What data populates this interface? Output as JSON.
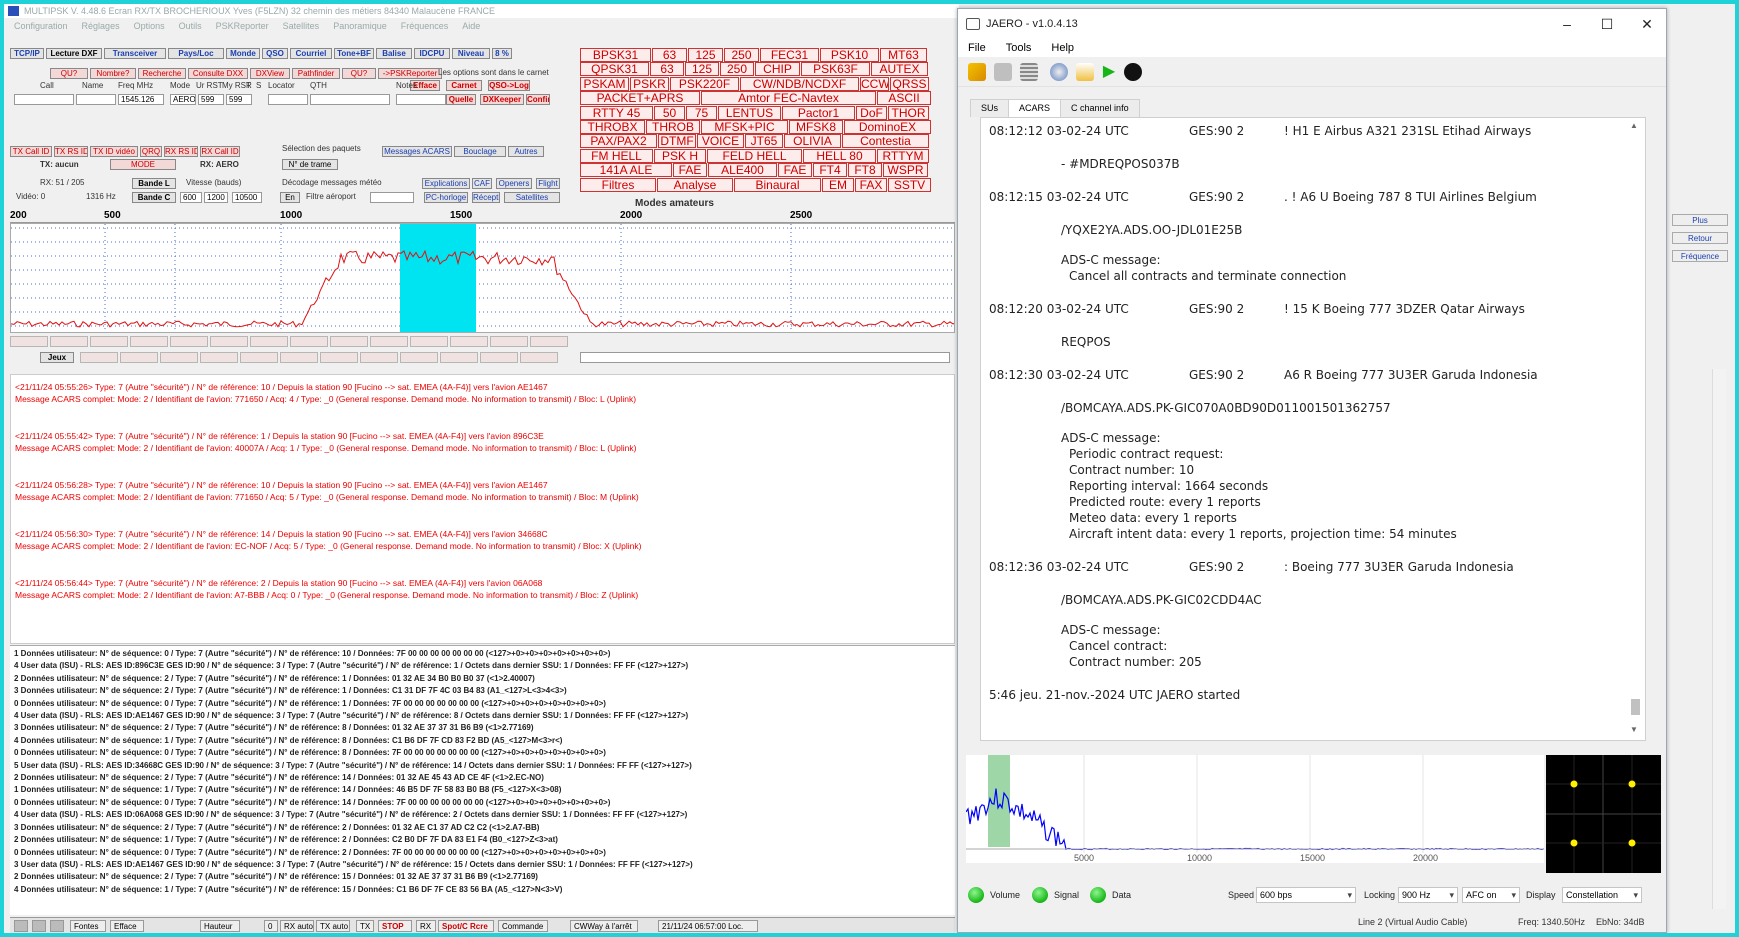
{
  "multipsk": {
    "title": "MULTIPSK V. 4.48.6  Ecran RX/TX  BROCHERIOUX Yves (F5LZN)  32 chemin des métiers  84340 Malaucène  FRANCE",
    "menu": [
      "Configuration",
      "Réglages",
      "Options",
      "Outils",
      "PSKReporter",
      "Satellites",
      "Panoramique",
      "Fréquences",
      "Aide"
    ],
    "toolbar1": [
      "TCP/IP",
      "Lecture DXF",
      "Transceiver",
      "Pays/Loc",
      "Monde",
      "QSO",
      "Courriel",
      "Tone+BF",
      "Balise",
      "IDCPU",
      "Niveau",
      "8 %"
    ],
    "toolbar2": [
      "QU?",
      "Nombre?",
      "Recherche",
      "Consulte DXX",
      "DXView",
      "Pathfinder",
      "QU?",
      "->PSKReporter"
    ],
    "carnet_note": "Les options sont dans le carnet",
    "carnet_buttons": [
      "Efface",
      "Carnet",
      "QSO->Log",
      "Quelle",
      "DXKeeper",
      "Confir"
    ],
    "log_headers": [
      "Call",
      "Name",
      "Freq MHz",
      "Mode",
      "Ur RST",
      "My RST",
      "R",
      "S",
      "Locator",
      "QTH",
      "Notes"
    ],
    "log_values": {
      "freq": "1545.126",
      "mode": "AERO",
      "ur_rst": "599",
      "my_rst": "599"
    },
    "tx_buttons": [
      "TX Call ID",
      "TX RS ID",
      "TX ID vidéo",
      "QRQ",
      "RX RS ID",
      "RX Call ID"
    ],
    "packet_selection": "Sélection des paquets",
    "acars_buttons": [
      "Messages ACARS",
      "Bouclage",
      "Autres"
    ],
    "tx_mode": {
      "tx": "TX: aucun",
      "mode": "MODE",
      "rx": "RX: AERO",
      "frame": "N° de trame"
    },
    "rx_info": {
      "rx": "RX: 51 / 205",
      "bande_l": "Bande L",
      "bande_c": "Bande C",
      "vitesse": "Vitesse (bauds)",
      "v600": "600",
      "v1200": "1200",
      "v10500": "10500",
      "weather": "Décodage messages météo",
      "en": "En",
      "filtre": "Filtre aéroport",
      "videau": "Vidéo: 0",
      "freq_hz": "1316 Hz"
    },
    "misc_buttons": [
      "Explications",
      "CAF",
      "Openers",
      "Flight",
      "PC-horloge",
      "Réception",
      "Satellites"
    ],
    "modes": [
      [
        "BPSK31",
        "63",
        "125",
        "250",
        "FEC31",
        "PSK10",
        "MT63"
      ],
      [
        "QPSK31",
        "63",
        "125",
        "250",
        "CHIP",
        "PSK63F",
        "AUTEX"
      ],
      [
        "PSKAM",
        "PSKR",
        "PSK220F",
        "CW/NDB/NCDXF",
        "CCW",
        "QRSS"
      ],
      [
        "PACKET+APRS",
        "Amtor FEC-Navtex",
        "ASCII"
      ],
      [
        "RTTY 45",
        "50",
        "75",
        "LENTUS",
        "Pactor1",
        "DoF",
        "THOR"
      ],
      [
        "THROBX",
        "THROB",
        "MFSK+PIC",
        "MFSK8",
        "DominoEX"
      ],
      [
        "PAX/PAX2",
        "DTMF",
        "VOICE",
        "JT65",
        "OLIVIA",
        "Contestia"
      ],
      [
        "FM HELL",
        "PSK H",
        "FELD HELL",
        "HELL 80",
        "RTTYM"
      ],
      [
        "141A ALE",
        "FAE",
        "ALE400",
        "FAE",
        "FT4",
        "FT8",
        "WSPR"
      ],
      [
        "Filtres",
        "Analyse",
        "Binaural",
        "EM",
        "FAX",
        "SSTV"
      ]
    ],
    "modes_caption": "Modes amateurs",
    "scale_labels": [
      "200",
      "500",
      "1000",
      "1500",
      "2000",
      "2500"
    ],
    "jeux_label": "Jeux",
    "log_entries": [
      {
        "l1": "<21/11/24 05:55:26> Type: 7 (Autre \"sécurité\") / N° de référence: 10 / Depuis la station 90 [Fucino --> sat. EMEA (4A-F4)] vers l'avion AE1467",
        "l2": "Message ACARS complet:  Mode: 2 / Identifiant de l'avion: 771650 / Acq: 4 / Type: _0 (General response. Demand mode. No information to transmit) / Bloc: L (Uplink)"
      },
      {
        "l1": "<21/11/24 05:55:42> Type: 7 (Autre \"sécurité\") / N° de référence: 1 / Depuis la station 90 [Fucino --> sat. EMEA (4A-F4)] vers l'avion 896C3E",
        "l2": "Message ACARS complet:  Mode: 2 / Identifiant de l'avion: 40007A / Acq: 1 / Type: _0 (General response. Demand mode. No information to transmit) / Bloc: L (Uplink)"
      },
      {
        "l1": "<21/11/24 05:56:28> Type: 7 (Autre \"sécurité\") / N° de référence: 10 / Depuis la station 90 [Fucino --> sat. EMEA (4A-F4)] vers l'avion AE1467",
        "l2": "Message ACARS complet:  Mode: 2 / Identifiant de l'avion: 771650 / Acq: 5 / Type: _0 (General response. Demand mode. No information to transmit) / Bloc: M (Uplink)"
      },
      {
        "l1": "<21/11/24 05:56:30> Type: 7 (Autre \"sécurité\") / N° de référence: 14 / Depuis la station 90 [Fucino --> sat. EMEA (4A-F4)] vers l'avion 34668C",
        "l2": "Message ACARS complet:  Mode: 2 / Identifiant de l'avion: EC-NOF / Acq: 5 / Type: _0 (General response. Demand mode. No information to transmit) / Bloc: X (Uplink)"
      },
      {
        "l1": "<21/11/24 05:56:44> Type: 7 (Autre \"sécurité\") / N° de référence: 2 / Depuis la station 90 [Fucino --> sat. EMEA (4A-F4)] vers l'avion 06A068",
        "l2": "Message ACARS complet:  Mode: 2 / Identifiant de l'avion: A7-BBB / Acq: 0 / Type: _0 (General response. Demand mode. No information to transmit) / Bloc: Z (Uplink)"
      }
    ],
    "bottom_lines": [
      "1 Données utilisateur: N° de séquence: 0 / Type: 7 (Autre \"sécurité\") / N° de référence: 10 / Données: 7F 00 00 00 00 00 00 00 (<127>+0>+0>+0>+0>+0>+0>+0>)",
      "4 User data (ISU) - RLS: AES ID:896C3E GES ID:90 / N° de séquence: 3 / Type: 7 (Autre \"sécurité\") / N° de référence: 1 / Octets dans dernier SSU: 1 / Données: FF FF (<127>+127>)",
      "2 Données utilisateur: N° de séquence: 2 / Type: 7 (Autre \"sécurité\") / N° de référence: 1 / Données: 01 32 AE 34 B0 B0 B0 37 (<1>2.40007)",
      "3 Données utilisateur: N° de séquence: 2 / Type: 7 (Autre \"sécurité\") / N° de référence: 1 / Données: C1 31 DF 7F 4C 03 B4 83 (A1_<127>L<3>4<3>)",
      "0 Données utilisateur: N° de séquence: 0 / Type: 7 (Autre \"sécurité\") / N° de référence: 1 / Données: 7F 00 00 00 00 00 00 00 (<127>+0>+0>+0>+0>+0>+0>+0>)",
      "4 User data (ISU) - RLS: AES ID:AE1467 GES ID:90 / N° de séquence: 3 / Type: 7 (Autre \"sécurité\") / N° de référence: 8 / Octets dans dernier SSU: 1 / Données: FF FF (<127>+127>)",
      "3 Données utilisateur: N° de séquence: 2 / Type: 7 (Autre \"sécurité\") / N° de référence: 8 / Données: 01 32 AE 37 37 31 B6 B9 (<1>2.77169)",
      "4 Données utilisateur: N° de séquence: 1 / Type: 7 (Autre \"sécurité\") / N° de référence: 8 / Données: C1 B6 DF 7F CD 83 F2 BD (A5_<127>M<3>r<)",
      "0 Données utilisateur: N° de séquence: 0 / Type: 7 (Autre \"sécurité\") / N° de référence: 8 / Données: 7F 00 00 00 00 00 00 00 (<127>+0>+0>+0>+0>+0>+0>+0>)",
      "5 User data (ISU) - RLS: AES ID:34668C GES ID:90 / N° de séquence: 3 / Type: 7 (Autre \"sécurité\") / N° de référence: 14 / Octets dans dernier SSU: 1 / Données: FF FF (<127>+127>)",
      "2 Données utilisateur: N° de séquence: 2 / Type: 7 (Autre \"sécurité\") / N° de référence: 14 / Données: 01 32 AE 45 43 AD CE 4F (<1>2.EC-NO)",
      "1 Données utilisateur: N° de séquence: 1 / Type: 7 (Autre \"sécurité\") / N° de référence: 14 / Données: 46 B5 DF 7F 58 83 B0 B8 (F5_<127>X<3>08)",
      "0 Données utilisateur: N° de séquence: 0 / Type: 7 (Autre \"sécurité\") / N° de référence: 14 / Données: 7F 00 00 00 00 00 00 00 (<127>+0>+0>+0>+0>+0>+0>+0>)",
      "4 User data (ISU) - RLS: AES ID:06A068 GES ID:90 / N° de séquence: 3 / Type: 7 (Autre \"sécurité\") / N° de référence: 2 / Octets dans dernier SSU: 1 / Données: FF FF (<127>+127>)",
      "3 Données utilisateur: N° de séquence: 2 / Type: 7 (Autre \"sécurité\") / N° de référence: 2 / Données: 01 32 AE C1 37 AD C2 C2 (<1>2.A7-BB)",
      "2 Données utilisateur: N° de séquence: 1 / Type: 7 (Autre \"sécurité\") / N° de référence: 2 / Données: C2 B0 DF 7F DA 83 E1 F4 (B0_<127>Z<3>at)",
      "0 Données utilisateur: N° de séquence: 0 / Type: 7 (Autre \"sécurité\") / N° de référence: 2 / Données: 7F 00 00 00 00 00 00 00 (<127>+0>+0>+0>+0>+0>+0>+0>)",
      "3 User data (ISU) - RLS: AES ID:AE1467 GES ID:90 / N° de séquence: 3 / Type: 7 (Autre \"sécurité\") / N° de référence: 15 / Octets dans dernier SSU: 1 / Données: FF FF (<127>+127>)",
      "2 Données utilisateur: N° de séquence: 2 / Type: 7 (Autre \"sécurité\") / N° de référence: 15 / Données: 01 32 AE 37 37 31 B6 B9 (<1>2.77169)",
      "4 Données utilisateur: N° de séquence: 1 / Type: 7 (Autre \"sécurité\") / N° de référence: 15 / Données: C1 B6 DF 7F CE 83 56 BA (A5_<127>N<3>V)"
    ],
    "status": {
      "fontes": "Fontes",
      "efface": "Efface",
      "hauteur": "Hauteur",
      "zero": "0",
      "rx_auto": "RX auto",
      "tx_auto": "TX auto",
      "tx": "TX",
      "stop": "STOP",
      "rx": "RX",
      "spot": "Spot/C Rcre",
      "commande": "Commande",
      "delay": "CWWay à l'arrêt",
      "datetime": "21/11/24 06:57:00 Loc."
    }
  },
  "rightstrip": [
    "Plus",
    "Retour",
    "Fréquence"
  ],
  "jaero": {
    "title": "JAERO - v1.0.4.13",
    "menu": [
      "File",
      "Tools",
      "Help"
    ],
    "tabs": [
      "SUs",
      "ACARS",
      "C channel info"
    ],
    "messages": [
      {
        "time": "08:12:12 03-02-24 UTC",
        "ges": "GES:90 2",
        "ac": "! H1 E Airbus A321 231SL Etihad Airways",
        "body": [
          {
            "t": "- #MDREQPOS037B",
            "indent": false
          }
        ]
      },
      {
        "time": "08:12:15 03-02-24 UTC",
        "ges": "GES:90 2",
        "ac": ". ! A6 U Boeing 787 8 TUI Airlines Belgium",
        "body": [
          {
            "t": "/YQXE2YA.ADS.OO-JDL01E25B",
            "indent": false
          },
          {
            "t": "",
            "indent": false
          },
          {
            "t": "ADS-C message:",
            "indent": false
          },
          {
            "t": "Cancel all contracts and terminate connection",
            "indent": true
          }
        ]
      },
      {
        "time": "08:12:20 03-02-24 UTC",
        "ges": "GES:90 2",
        "ac": "! 15 K Boeing 777 3DZER Qatar Airways",
        "body": [
          {
            "t": "REQPOS",
            "indent": false
          }
        ]
      },
      {
        "time": "08:12:30 03-02-24 UTC",
        "ges": "GES:90 2",
        "ac": "A6 R Boeing 777 3U3ER Garuda Indonesia",
        "body": [
          {
            "t": "/BOMCAYA.ADS.PK-GIC070A0BD90D011001501362757",
            "indent": false
          },
          {
            "t": "",
            "indent": false
          },
          {
            "t": "ADS-C message:",
            "indent": false
          },
          {
            "t": "Periodic contract request:",
            "indent": true
          },
          {
            "t": "Contract number: 10",
            "indent": true
          },
          {
            "t": "Reporting interval: 1664 seconds",
            "indent": true
          },
          {
            "t": "Predicted route: every 1 reports",
            "indent": true
          },
          {
            "t": "Meteo data: every 1 reports",
            "indent": true
          },
          {
            "t": "Aircraft intent data: every 1 reports, projection time: 54 minutes",
            "indent": true
          }
        ]
      },
      {
        "time": "08:12:36 03-02-24 UTC",
        "ges": "GES:90 2",
        "ac": ": Boeing 777 3U3ER Garuda Indonesia",
        "body": [
          {
            "t": "/BOMCAYA.ADS.PK-GIC02CDD4AC",
            "indent": false
          },
          {
            "t": "",
            "indent": false
          },
          {
            "t": "ADS-C message:",
            "indent": false
          },
          {
            "t": "Cancel contract:",
            "indent": true
          },
          {
            "t": "Contract number: 205",
            "indent": true
          }
        ]
      }
    ],
    "started": "5:46 jeu. 21-nov.-2024 UTC JAERO started",
    "spec_ticks": [
      "5000",
      "10000",
      "15000",
      "20000"
    ],
    "controls": {
      "volume": "Volume",
      "signal": "Signal",
      "data": "Data",
      "speed_label": "Speed",
      "speed": "600 bps",
      "locking_label": "Locking",
      "locking": "900 Hz",
      "afc": "AFC on",
      "display_label": "Display",
      "display": "Constellation"
    },
    "status": {
      "line": "Line 2 (Virtual Audio Cable)",
      "freq": "Freq: 1340.50Hz",
      "ebno": "EbNo: 34dB"
    },
    "colors": {
      "spectrum": "#0000ff",
      "passband": "#9fd6a8",
      "constellation_dot": "#ffee00"
    }
  }
}
